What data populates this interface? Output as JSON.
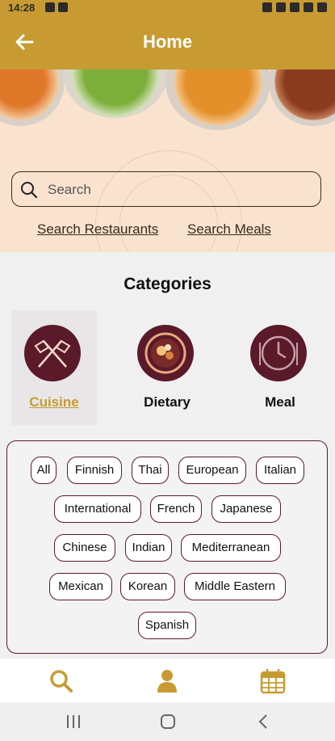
{
  "status_bar": {
    "time": "14:28"
  },
  "app_bar": {
    "title": "Home",
    "back_icon": "arrow-left-icon"
  },
  "search": {
    "placeholder": "Search",
    "value": ""
  },
  "search_links": [
    "Search Restaurants",
    "Search Meals"
  ],
  "categories": {
    "title": "Categories",
    "items": [
      {
        "label": "Cuisine",
        "icon": "crossed-flags-icon",
        "selected": true
      },
      {
        "label": "Dietary",
        "icon": "vegetables-plate-icon",
        "selected": false
      },
      {
        "label": "Meal",
        "icon": "clock-cutlery-icon",
        "selected": false
      }
    ]
  },
  "cuisine_chips": [
    "All",
    "Finnish",
    "Thai",
    "European",
    "Italian",
    "International",
    "French",
    "Japanese",
    "Chinese",
    "Indian",
    "Mediterranean",
    "Mexican",
    "Korean",
    "Middle Eastern",
    "Spanish"
  ],
  "bottom_nav": [
    "search-icon",
    "user-icon",
    "calendar-icon"
  ],
  "system_nav": [
    "recent-apps-icon",
    "home-icon",
    "back-icon"
  ],
  "colors": {
    "accent": "#c79b32",
    "maroon": "#5a1a2a",
    "banner": "#f9e3cf"
  }
}
